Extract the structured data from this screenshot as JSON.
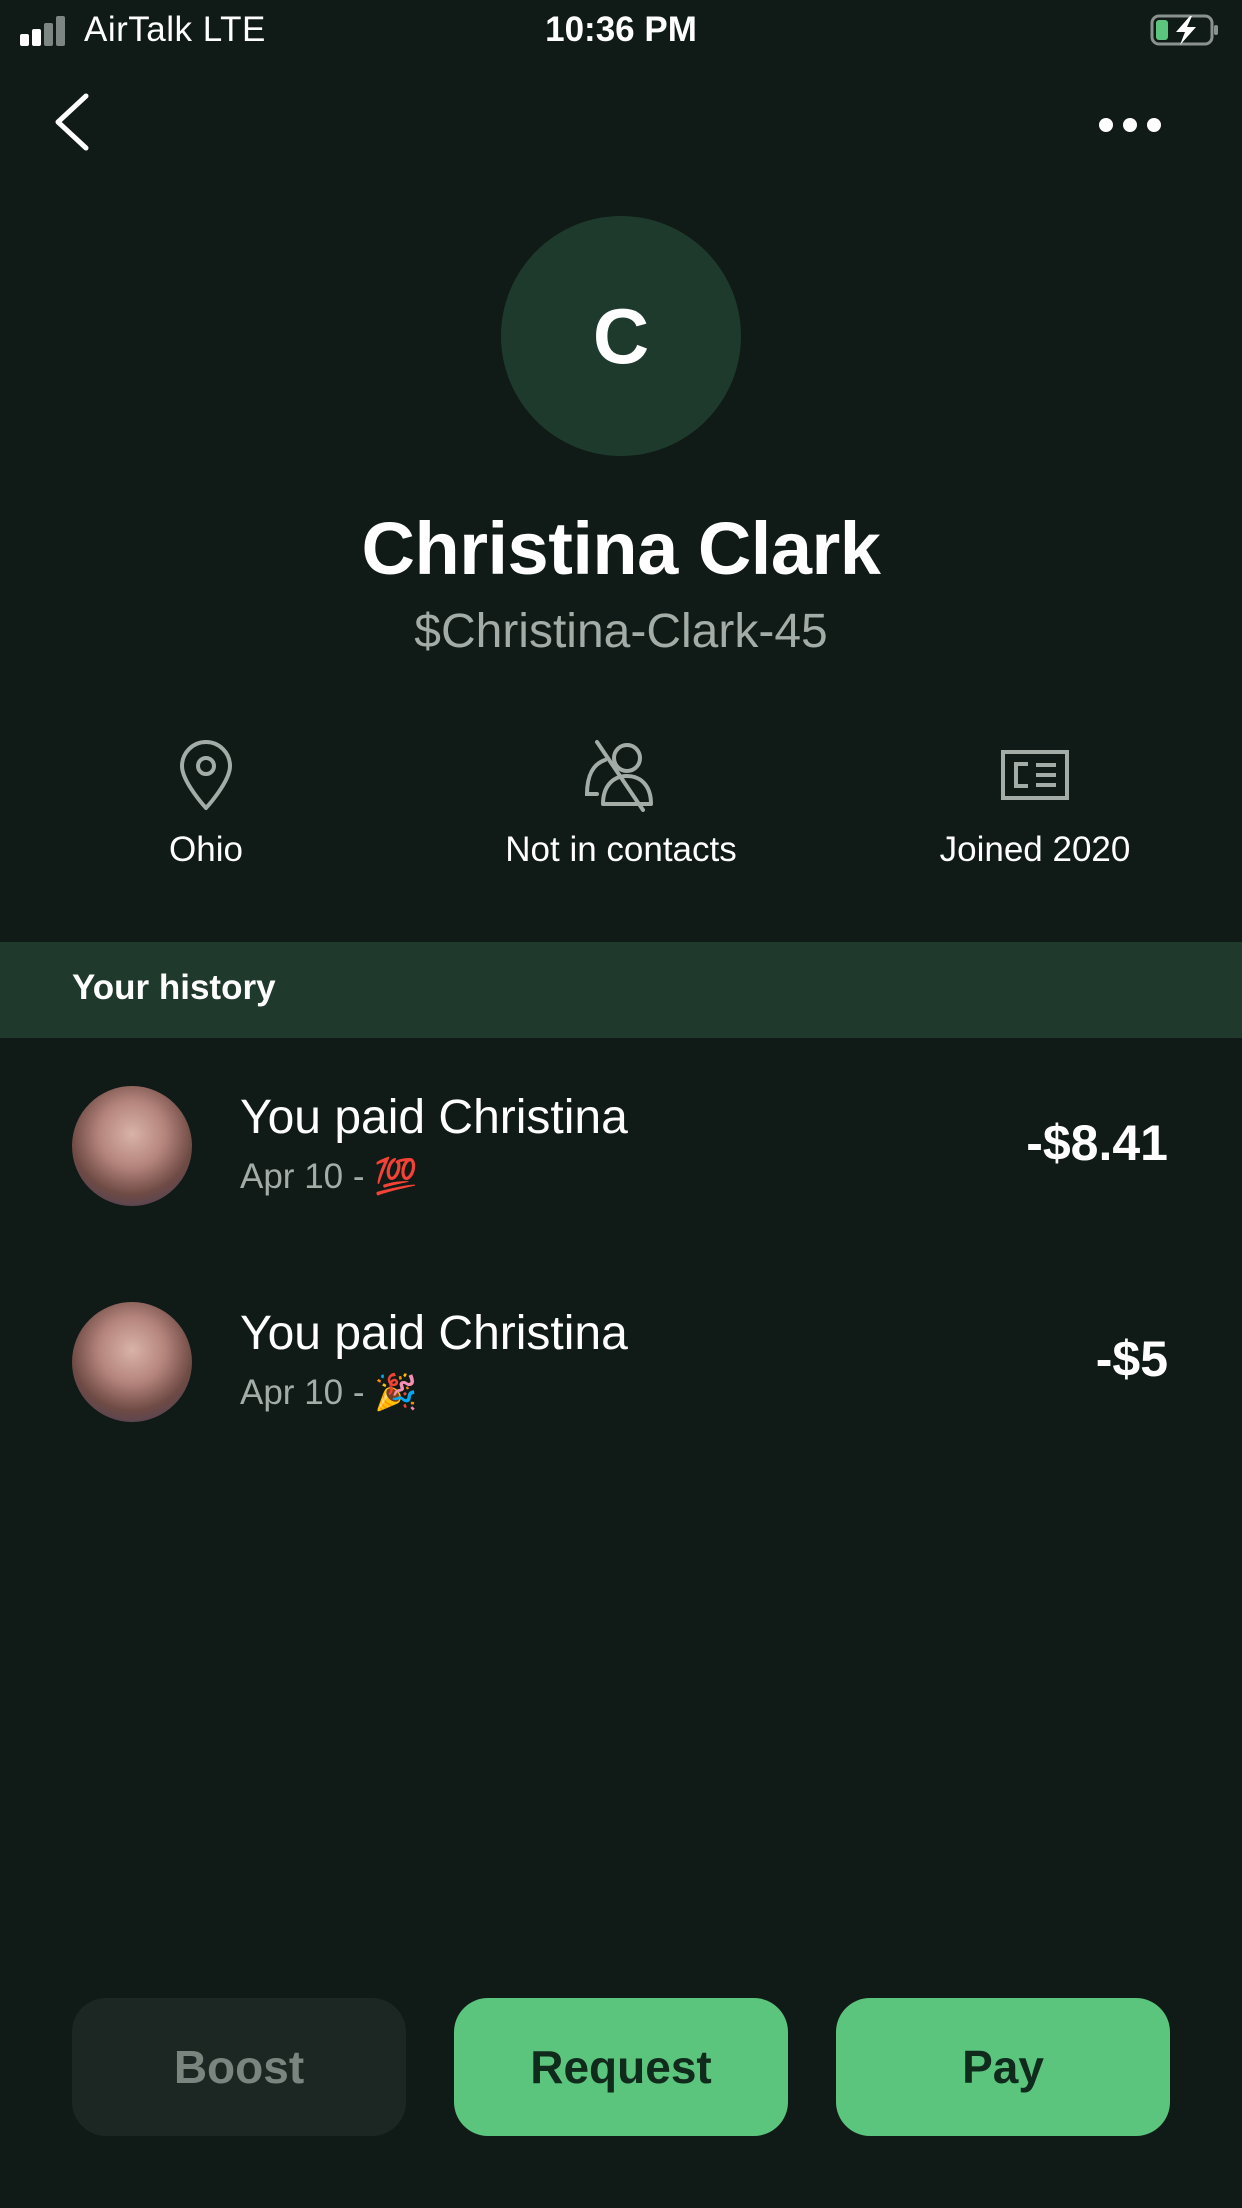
{
  "status_bar": {
    "carrier": "AirTalk   LTE",
    "time": "10:36 PM"
  },
  "profile": {
    "initial": "C",
    "name": "Christina Clark",
    "cashtag": "$Christina-Clark-45"
  },
  "info": {
    "location": "Ohio",
    "contacts": "Not in contacts",
    "joined": "Joined 2020"
  },
  "history": {
    "header": "Your history",
    "items": [
      {
        "title": "You paid Christina",
        "date": "Apr 10 - ",
        "emoji": "💯",
        "amount": "-$8.41"
      },
      {
        "title": "You paid Christina",
        "date": "Apr 10 - ",
        "emoji": "🎉",
        "amount": "-$5"
      }
    ]
  },
  "actions": {
    "boost": "Boost",
    "request": "Request",
    "pay": "Pay"
  },
  "colors": {
    "background": "#101a16",
    "accent": "#5bc57e",
    "header_band": "#1f3a2d",
    "avatar_bg": "#1e3a2d"
  }
}
